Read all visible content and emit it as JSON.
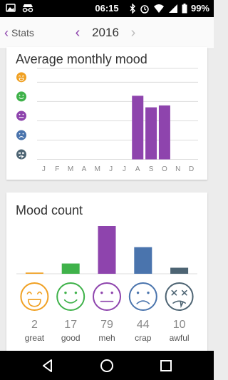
{
  "status_bar": {
    "time": "06:15",
    "battery": "99%",
    "left_icons": [
      "image-icon",
      "incognito-icon"
    ],
    "right_icons": [
      "bluetooth-icon",
      "alarm-icon",
      "wifi-icon",
      "signal-icon",
      "battery-icon"
    ]
  },
  "app_bar": {
    "back_label": "Stats",
    "year": "2016"
  },
  "colors": {
    "accent": "#8e44ad",
    "great": "#f0a022",
    "good": "#3fb24a",
    "meh": "#8e44ad",
    "crap": "#4a74ad",
    "awful": "#4d6473"
  },
  "monthly_card": {
    "title": "Average monthly mood"
  },
  "count_card": {
    "title": "Mood count"
  },
  "chart_data": [
    {
      "type": "bar",
      "title": "Average monthly mood",
      "categories": [
        "J",
        "F",
        "M",
        "A",
        "M",
        "J",
        "J",
        "A",
        "S",
        "O",
        "N",
        "D"
      ],
      "values": [
        null,
        null,
        null,
        null,
        null,
        null,
        null,
        3.3,
        2.7,
        2.8,
        null,
        null
      ],
      "ylim": [
        0,
        5
      ],
      "y_levels": [
        "awful",
        "crap",
        "meh",
        "good",
        "great"
      ],
      "grid": true
    },
    {
      "type": "bar",
      "title": "Mood count",
      "categories": [
        "great",
        "good",
        "meh",
        "crap",
        "awful"
      ],
      "values": [
        2,
        17,
        79,
        44,
        10
      ],
      "labels": [
        "2",
        "17",
        "79",
        "44",
        "10"
      ],
      "ylim": [
        0,
        79
      ]
    }
  ],
  "navbar": {
    "icons": [
      "back-triangle-icon",
      "home-circle-icon",
      "recents-square-icon"
    ]
  }
}
